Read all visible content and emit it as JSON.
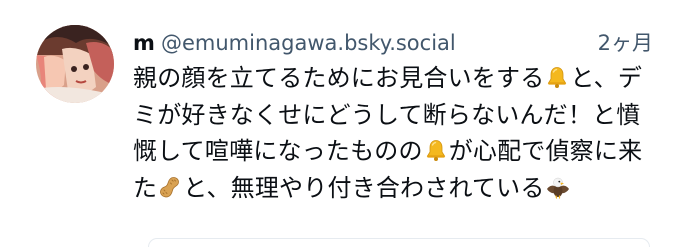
{
  "post": {
    "author": {
      "display_name": "m",
      "handle": "@emuminagawa.bsky.social"
    },
    "timestamp": "2ヶ月",
    "text_segments": [
      {
        "type": "text",
        "value": "親の顔を立てるためにお見合いをする"
      },
      {
        "type": "emoji",
        "icon": "bell-icon"
      },
      {
        "type": "text",
        "value": "と、デミが好きなくせにどうして断らないんだ！と憤慨して喧嘩になったものの"
      },
      {
        "type": "emoji",
        "icon": "bell-icon"
      },
      {
        "type": "text",
        "value": "が心配で偵察に来た"
      },
      {
        "type": "emoji",
        "icon": "peanut-icon"
      },
      {
        "type": "text",
        "value": "と、無理やり付き合わされている"
      },
      {
        "type": "emoji",
        "icon": "eagle-icon"
      }
    ]
  },
  "colors": {
    "text_primary": "#0b0f14",
    "text_secondary": "#42576c",
    "border": "#e6ebf0"
  }
}
